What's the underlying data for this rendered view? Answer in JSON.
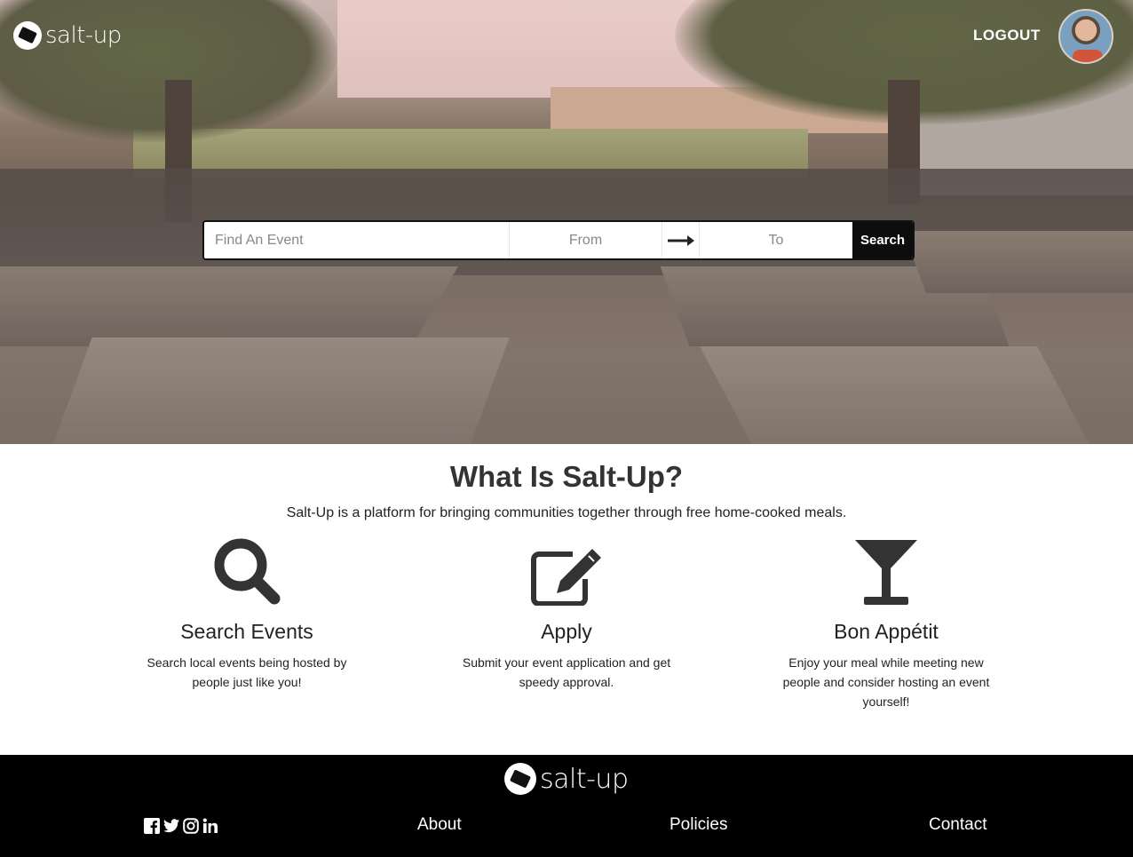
{
  "brand": {
    "name": "salt-up"
  },
  "nav": {
    "logout_label": "LOGOUT"
  },
  "search": {
    "find_placeholder": "Find An Event",
    "from_placeholder": "From",
    "to_placeholder": "To",
    "button_label": "Search"
  },
  "about": {
    "title": "What Is Salt-Up?",
    "description": "Salt-Up is a platform for bringing communities together through free home-cooked meals.",
    "features": [
      {
        "icon": "search-icon",
        "title": "Search Events",
        "text": "Search local events being hosted by people just like you!"
      },
      {
        "icon": "edit-icon",
        "title": "Apply",
        "text": "Submit your event application and get speedy approval."
      },
      {
        "icon": "glass-icon",
        "title": "Bon Appétit",
        "text": "Enjoy your meal while meeting new people and consider hosting an event yourself!"
      }
    ]
  },
  "footer": {
    "social_icons": [
      "facebook-icon",
      "twitter-icon",
      "instagram-icon",
      "linkedin-icon"
    ],
    "links": [
      "About",
      "Policies",
      "Contact"
    ]
  },
  "colors": {
    "footer_bg": "#000000",
    "search_button_bg": "#0d0d0d",
    "text": "#333333"
  }
}
